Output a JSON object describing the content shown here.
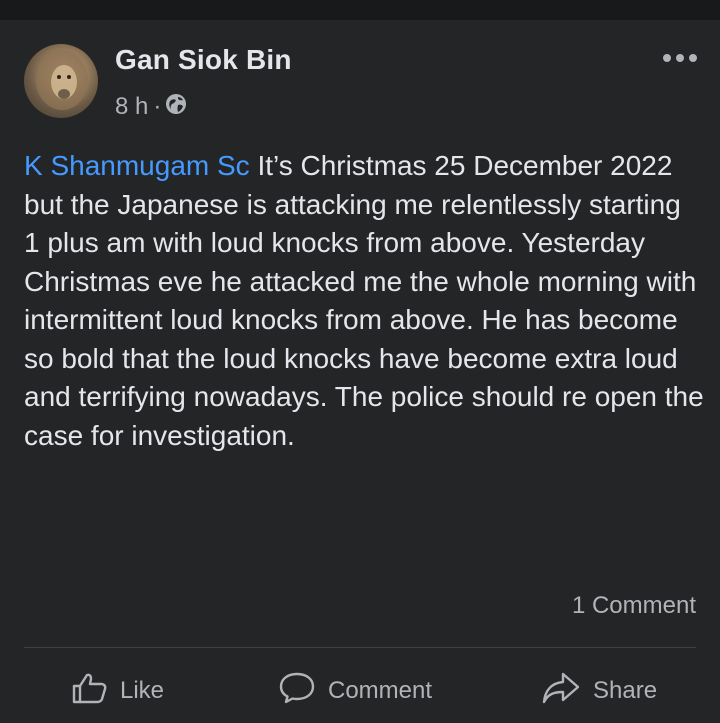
{
  "post": {
    "author": "Gan Siok Bin",
    "time": "8 h",
    "time_separator": "·",
    "privacy_icon": "globe-icon",
    "mention": "K Shanmugam Sc",
    "text": " It’s Christmas 25 December 2022 but the Japanese is attacking me relentlessly starting 1 plus am with loud knocks from above. Yesterday Christmas eve he attacked me the whole morning with intermittent loud knocks from above. He has become so bold that the loud knocks have become extra loud and terrifying nowadays. The police should re open the case for investigation.",
    "comment_count": "1 Comment"
  },
  "actions": {
    "like": "Like",
    "comment": "Comment",
    "share": "Share"
  },
  "colors": {
    "background": "#242526",
    "mention": "#4599ff",
    "secondary_text": "#b0b3b8"
  }
}
